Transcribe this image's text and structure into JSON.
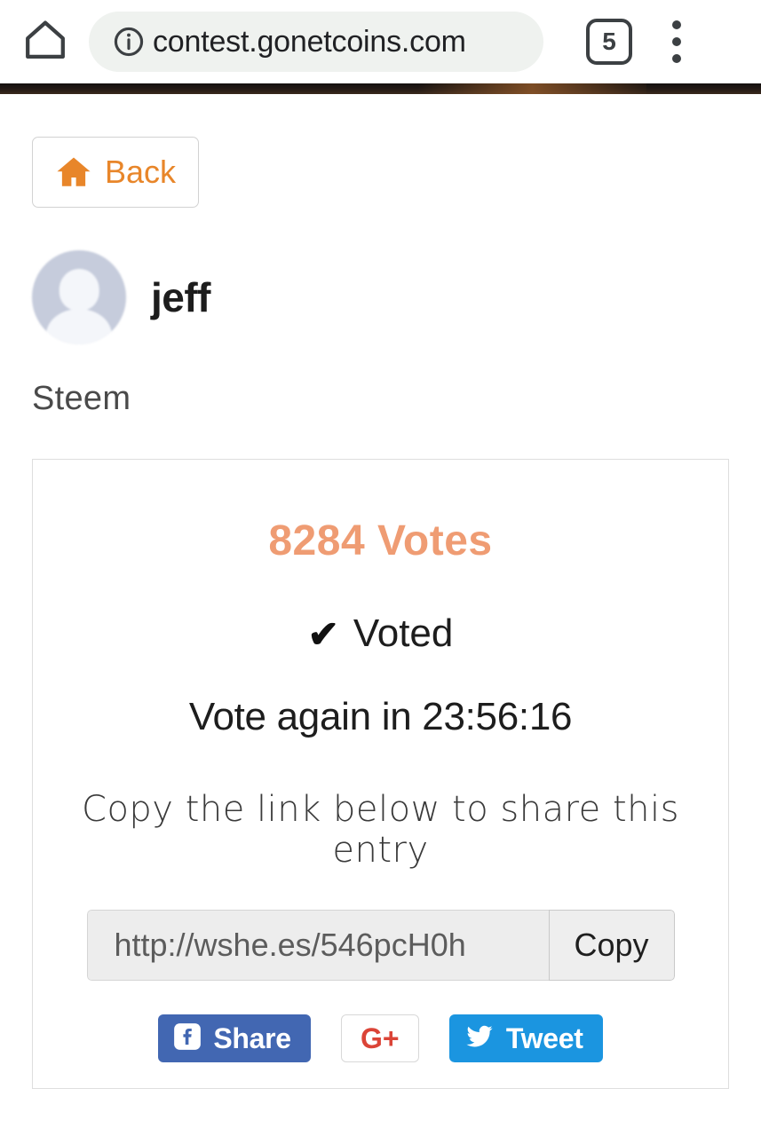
{
  "browser": {
    "home_icon": "home-icon",
    "info_icon": "info-icon",
    "url": "contest.gonetcoins.com",
    "tab_count": "5",
    "menu_icon": "three-dot-menu-icon"
  },
  "page": {
    "back_button": {
      "label": "Back",
      "icon": "house-icon",
      "color": "#e8862a"
    },
    "profile": {
      "avatar": "default-avatar-icon",
      "username": "jeff",
      "platform": "Steem"
    },
    "card": {
      "votes": "8284 Votes",
      "votes_color": "#ef9c73",
      "voted_check": "✔",
      "voted_label": "Voted",
      "vote_again": "Vote again in 23:56:16",
      "share_hint": "Copy the link below to share this entry",
      "share_link": "http://wshe.es/546pcH0h",
      "copy_label": "Copy",
      "social": {
        "facebook": {
          "label": "Share",
          "icon": "facebook-icon",
          "color": "#4267b2"
        },
        "google": {
          "label": "G+",
          "icon": "google-plus-icon",
          "color": "#db4437"
        },
        "twitter": {
          "label": "Tweet",
          "icon": "twitter-icon",
          "color": "#1b95e0"
        }
      }
    }
  }
}
